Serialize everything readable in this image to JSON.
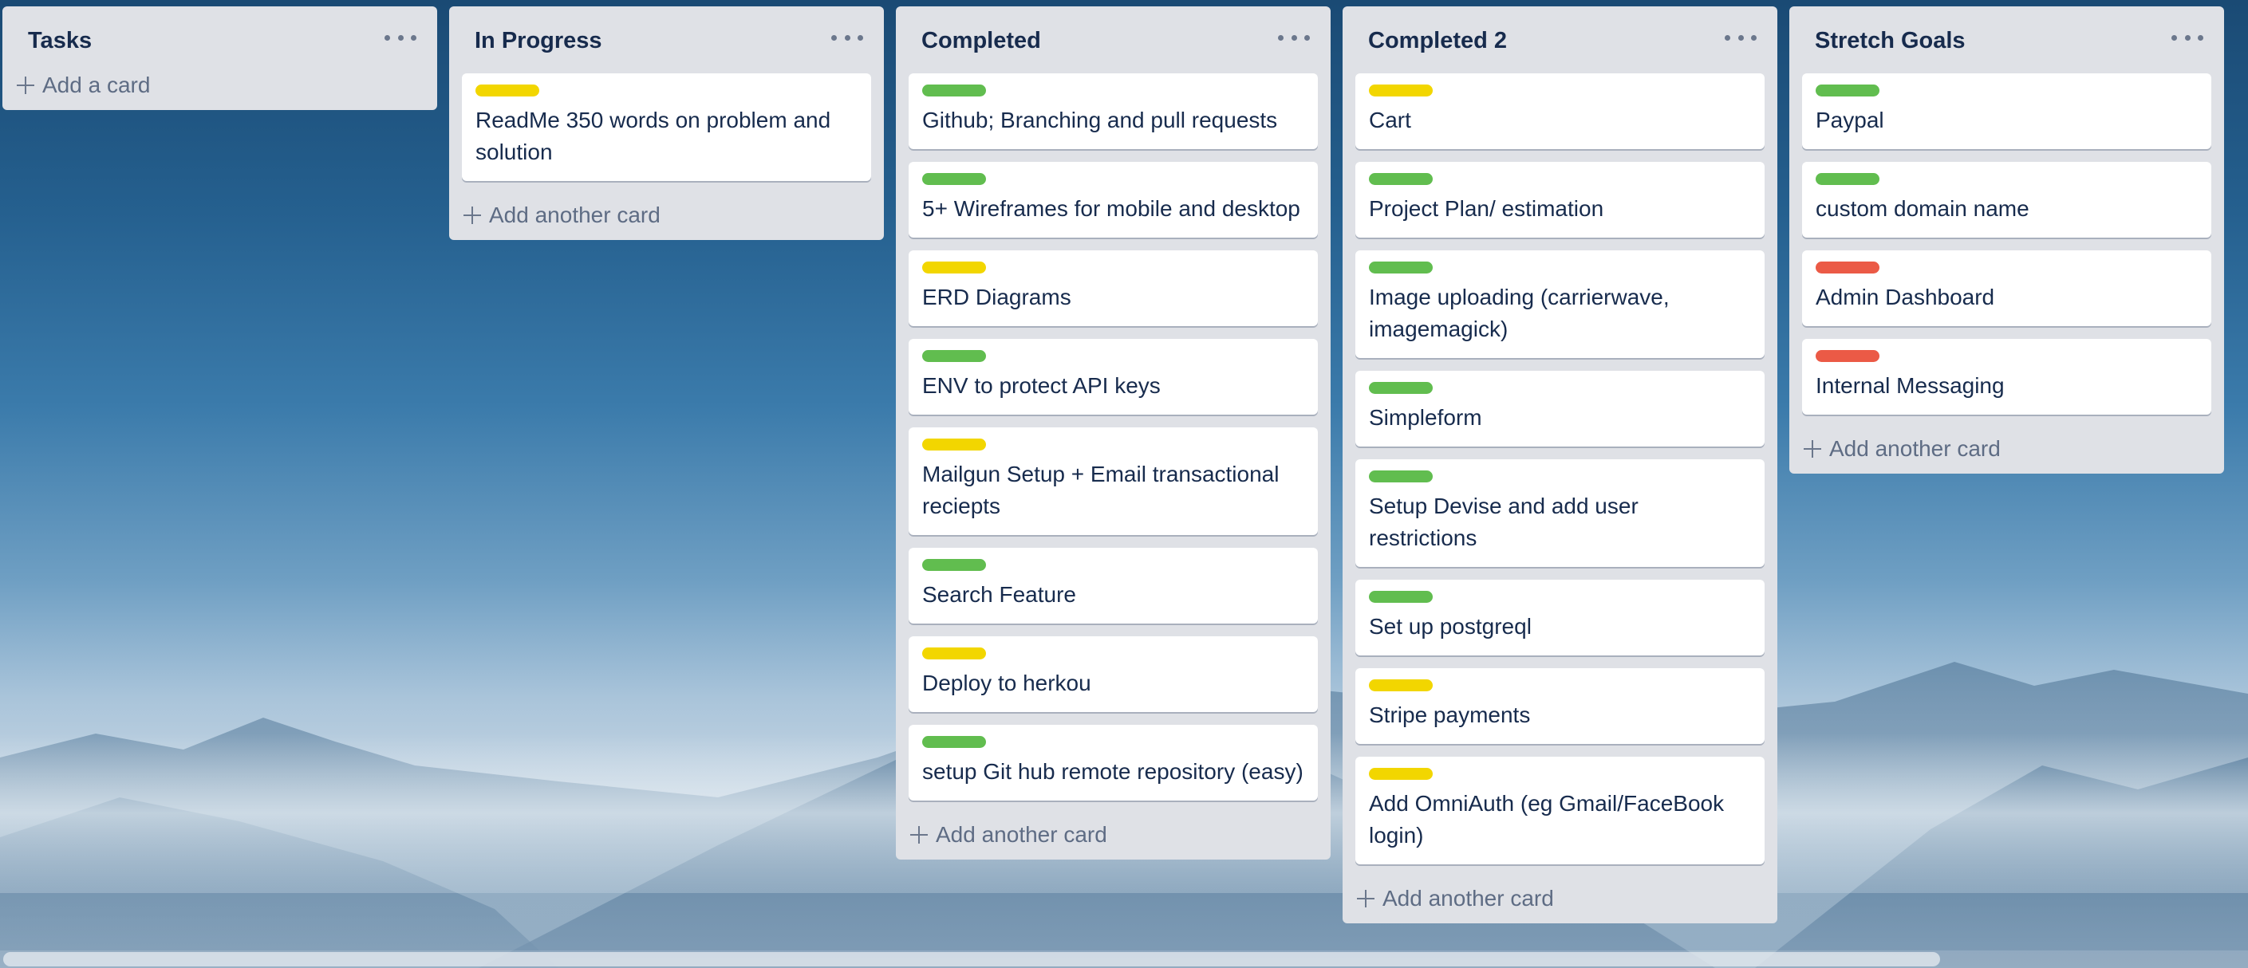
{
  "colors": {
    "green": "#61bd4f",
    "yellow": "#f2d600",
    "red": "#eb5a46",
    "list_bg": "#dfe1e6"
  },
  "lists": [
    {
      "title": "Tasks",
      "cards": [],
      "add_label": "Add a card"
    },
    {
      "title": "In Progress",
      "cards": [
        {
          "label": "yellow",
          "text": "ReadMe 350 words on problem and solution"
        }
      ],
      "add_label": "Add another card"
    },
    {
      "title": "Completed",
      "cards": [
        {
          "label": "green",
          "text": "Github; Branching and pull requests"
        },
        {
          "label": "green",
          "text": "5+ Wireframes for mobile and desktop"
        },
        {
          "label": "yellow",
          "text": "ERD Diagrams"
        },
        {
          "label": "green",
          "text": "ENV to protect API keys"
        },
        {
          "label": "yellow",
          "text": "Mailgun Setup + Email transactional reciepts"
        },
        {
          "label": "green",
          "text": "Search Feature"
        },
        {
          "label": "yellow",
          "text": "Deploy to herkou"
        },
        {
          "label": "green",
          "text": "setup Git hub remote repository (easy)"
        }
      ],
      "add_label": "Add another card"
    },
    {
      "title": "Completed 2",
      "cards": [
        {
          "label": "yellow",
          "text": "Cart"
        },
        {
          "label": "green",
          "text": "Project Plan/ estimation"
        },
        {
          "label": "green",
          "text": "Image uploading (carrierwave, imagemagick)"
        },
        {
          "label": "green",
          "text": "Simpleform"
        },
        {
          "label": "green",
          "text": "Setup Devise and add user restrictions"
        },
        {
          "label": "green",
          "text": "Set up postgreql"
        },
        {
          "label": "yellow",
          "text": "Stripe payments"
        },
        {
          "label": "yellow",
          "text": "Add OmniAuth (eg Gmail/FaceBook login)"
        }
      ],
      "add_label": "Add another card"
    },
    {
      "title": "Stretch Goals",
      "cards": [
        {
          "label": "green",
          "text": "Paypal"
        },
        {
          "label": "green",
          "text": "custom domain name"
        },
        {
          "label": "red",
          "text": "Admin Dashboard"
        },
        {
          "label": "red",
          "text": "Internal Messaging"
        }
      ],
      "add_label": "Add another card"
    }
  ]
}
